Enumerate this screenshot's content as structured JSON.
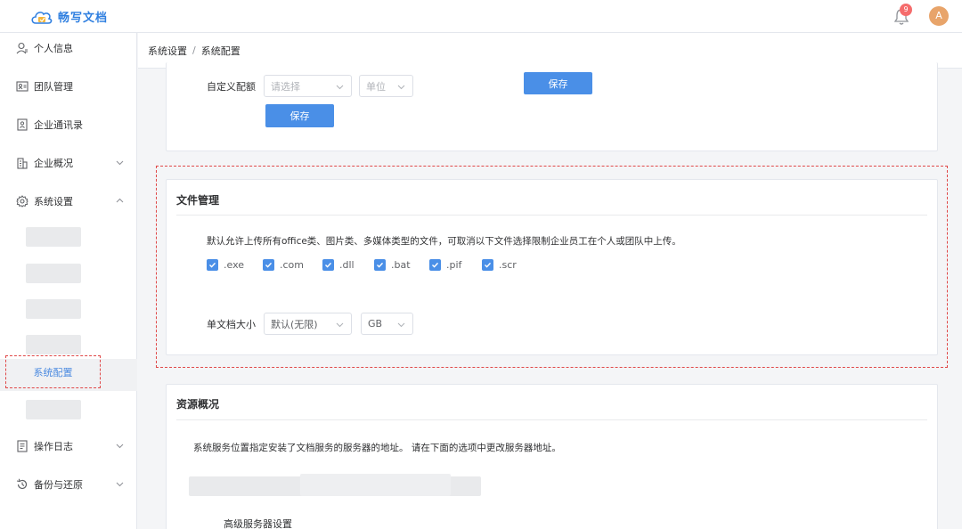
{
  "app": {
    "name": "畅写文档"
  },
  "header": {
    "notification_count": "9",
    "avatar_initial": "A"
  },
  "sidebar": {
    "items": [
      {
        "label": "个人信息"
      },
      {
        "label": "团队管理"
      },
      {
        "label": "企业通讯录"
      },
      {
        "label": "企业概况"
      },
      {
        "label": "系统设置"
      },
      {
        "label": "操作日志"
      },
      {
        "label": "备份与还原"
      }
    ],
    "active_sub": "系统配置"
  },
  "breadcrumb": {
    "parent": "系统设置",
    "separator": "/",
    "current": "系统配置"
  },
  "quota": {
    "label": "自定义配额",
    "select_placeholder": "请选择",
    "unit_placeholder": "单位",
    "save_label": "保存",
    "top_save_label": "保存"
  },
  "file_mgmt": {
    "title": "文件管理",
    "description": "默认允许上传所有office类、图片类、多媒体类型的文件，可取消以下文件选择限制企业员工在个人或团队中上传。",
    "extensions": [
      ".exe",
      ".com",
      ".dll",
      ".bat",
      ".pif",
      ".scr"
    ],
    "size_label": "单文档大小",
    "size_value": "默认(无限)",
    "size_unit": "GB"
  },
  "resources": {
    "title": "资源概况",
    "description": "系统服务位置指定安装了文档服务的服务器的地址。 请在下面的选项中更改服务器地址。",
    "advanced_label": "高级服务器设置"
  },
  "colors": {
    "primary": "#4a8fe7",
    "highlight": "#e04848"
  }
}
